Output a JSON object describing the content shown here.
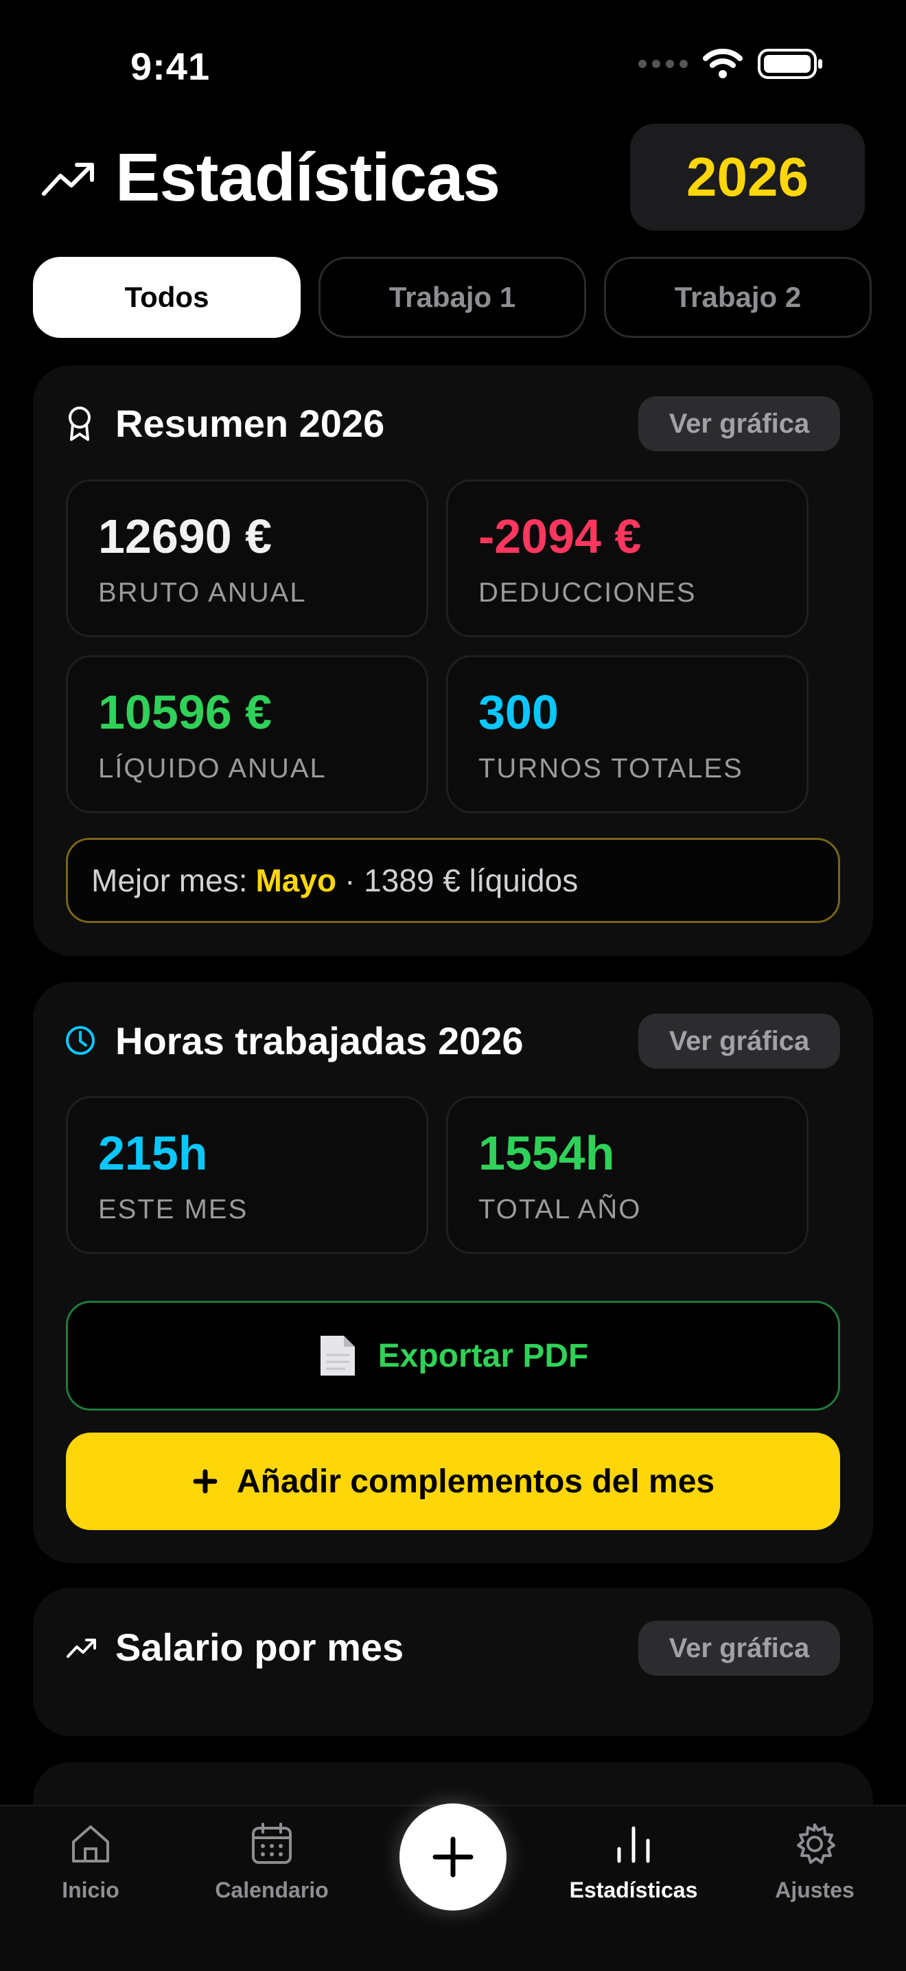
{
  "status_bar": {
    "time": "9:41"
  },
  "header": {
    "title": "Estadísticas",
    "year": "2026"
  },
  "tabs": [
    {
      "label": "Todos",
      "active": true
    },
    {
      "label": "Trabajo 1",
      "active": false
    },
    {
      "label": "Trabajo 2",
      "active": false
    }
  ],
  "summary": {
    "title": "Resumen 2026",
    "chart_button": "Ver gráfica",
    "stats": [
      {
        "value": "12690 €",
        "label": "BRUTO ANUAL",
        "color": "#f2f2f2"
      },
      {
        "value": "-2094 €",
        "label": "DEDUCCIONES",
        "color": "#ff375f"
      },
      {
        "value": "10596 €",
        "label": "LÍQUIDO ANUAL",
        "color": "#30d158"
      },
      {
        "value": "300",
        "label": "TURNOS TOTALES",
        "color": "#0ac8ff"
      }
    ],
    "best_month": {
      "prefix": "Mejor mes:",
      "month": "Mayo",
      "suffix": "· 1389 € líquidos"
    }
  },
  "hours": {
    "title": "Horas trabajadas 2026",
    "chart_button": "Ver gráfica",
    "stats": [
      {
        "value": "215h",
        "label": "ESTE MES",
        "color": "#0ac8ff"
      },
      {
        "value": "1554h",
        "label": "TOTAL AÑO",
        "color": "#30d158"
      }
    ],
    "export_label": "Exportar PDF",
    "add_label": "Añadir complementos del mes"
  },
  "salary": {
    "title": "Salario por mes",
    "chart_button": "Ver gráfica"
  },
  "nav": {
    "items": [
      {
        "label": "Inicio",
        "icon": "home-icon"
      },
      {
        "label": "Calendario",
        "icon": "calendar-icon"
      },
      {
        "label": "Estadísticas",
        "icon": "bar-chart-icon",
        "active": true
      },
      {
        "label": "Ajustes",
        "icon": "gear-icon"
      }
    ],
    "fab_icon": "plus-icon"
  },
  "colors": {
    "accent_yellow": "#ffd60a",
    "green": "#30d158",
    "red": "#ff375f",
    "cyan": "#0ac8ff"
  }
}
